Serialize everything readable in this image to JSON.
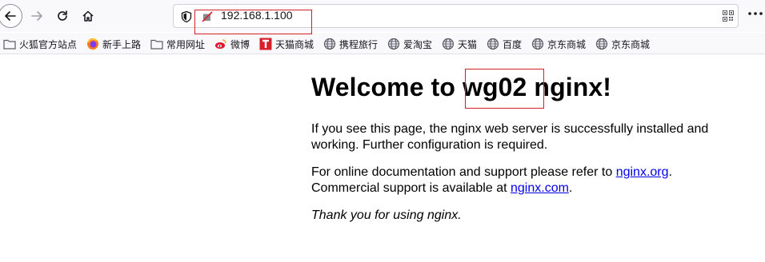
{
  "browser": {
    "url": "192.168.1.100"
  },
  "bookmarks": [
    {
      "label": "火狐官方站点",
      "icon": "folder-icon"
    },
    {
      "label": "新手上路",
      "icon": "firefox-icon"
    },
    {
      "label": "常用网址",
      "icon": "folder-icon"
    },
    {
      "label": "微博",
      "icon": "weibo-icon"
    },
    {
      "label": "天猫商城",
      "icon": "tmall-icon"
    },
    {
      "label": "携程旅行",
      "icon": "globe-icon"
    },
    {
      "label": "爱淘宝",
      "icon": "globe-icon"
    },
    {
      "label": "天猫",
      "icon": "globe-icon"
    },
    {
      "label": "百度",
      "icon": "globe-icon"
    },
    {
      "label": "京东商城",
      "icon": "globe-icon"
    },
    {
      "label": "京东商城",
      "icon": "globe-icon"
    }
  ],
  "page": {
    "heading_pre": "Welcome to ",
    "heading_host": "wg02",
    "heading_post": " nginx!",
    "p1_line1": "If you see this page, the nginx web server is successfully installed and",
    "p1_line2": "working. Further configuration is required.",
    "p2_line1_pre": "For online documentation and support please refer to ",
    "p2_link1": "nginx.org",
    "p2_line1_post": ".",
    "p2_line2_pre": "Commercial support is available at ",
    "p2_link2": "nginx.com",
    "p2_line2_post": ".",
    "p3": "Thank you for using nginx."
  },
  "colors": {
    "highlight_box": "#d8202b",
    "link": "#0000ee"
  }
}
